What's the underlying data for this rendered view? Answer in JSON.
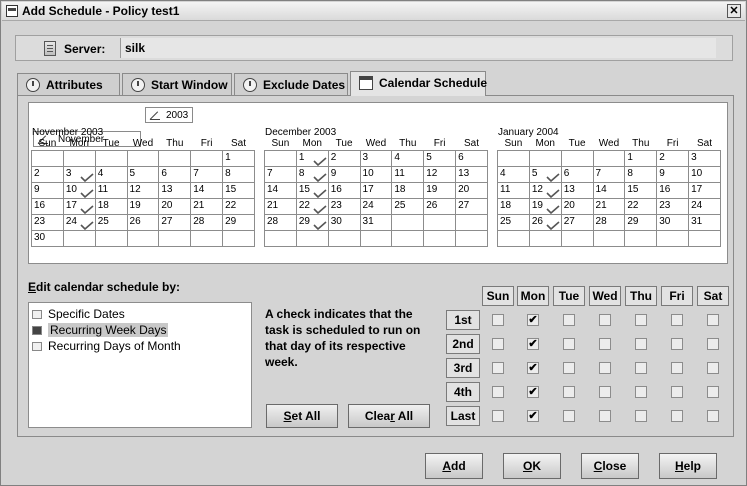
{
  "window": {
    "title": "Add Schedule - Policy test1",
    "close_label": "✕"
  },
  "server": {
    "label": "Server:",
    "value": "silk"
  },
  "tabs": [
    {
      "label": "Attributes",
      "icon": "gear-icon"
    },
    {
      "label": "Start Window",
      "icon": "clock-icon"
    },
    {
      "label": "Exclude Dates",
      "icon": "clock-icon"
    },
    {
      "label": "Calendar Schedule",
      "icon": "calendar-icon",
      "active": true
    }
  ],
  "nav": {
    "month": "November",
    "year": "2003"
  },
  "weekday_headers": [
    "Sun",
    "Mon",
    "Tue",
    "Wed",
    "Thu",
    "Fri",
    "Sat"
  ],
  "months": [
    {
      "title": "November 2003",
      "weeks": [
        [
          "",
          "",
          "",
          "",
          "",
          "",
          "1"
        ],
        [
          "2",
          "3",
          "4",
          "5",
          "6",
          "7",
          "8"
        ],
        [
          "9",
          "10",
          "11",
          "12",
          "13",
          "14",
          "15"
        ],
        [
          "16",
          "17",
          "18",
          "19",
          "20",
          "21",
          "22"
        ],
        [
          "23",
          "24",
          "25",
          "26",
          "27",
          "28",
          "29"
        ],
        [
          "30",
          "",
          "",
          "",
          "",
          "",
          ""
        ]
      ],
      "checked": [
        "3",
        "10",
        "17",
        "24"
      ]
    },
    {
      "title": "December 2003",
      "weeks": [
        [
          "",
          "1",
          "2",
          "3",
          "4",
          "5",
          "6"
        ],
        [
          "7",
          "8",
          "9",
          "10",
          "11",
          "12",
          "13"
        ],
        [
          "14",
          "15",
          "16",
          "17",
          "18",
          "19",
          "20"
        ],
        [
          "21",
          "22",
          "23",
          "24",
          "25",
          "26",
          "27"
        ],
        [
          "28",
          "29",
          "30",
          "31",
          "",
          "",
          ""
        ],
        [
          "",
          "",
          "",
          "",
          "",
          "",
          ""
        ]
      ],
      "checked": [
        "1",
        "8",
        "15",
        "22",
        "29"
      ]
    },
    {
      "title": "January 2004",
      "weeks": [
        [
          "",
          "",
          "",
          "",
          "1",
          "2",
          "3"
        ],
        [
          "4",
          "5",
          "6",
          "7",
          "8",
          "9",
          "10"
        ],
        [
          "11",
          "12",
          "13",
          "14",
          "15",
          "16",
          "17"
        ],
        [
          "18",
          "19",
          "20",
          "21",
          "22",
          "23",
          "24"
        ],
        [
          "25",
          "26",
          "27",
          "28",
          "29",
          "30",
          "31"
        ],
        [
          "",
          "",
          "",
          "",
          "",
          "",
          ""
        ]
      ],
      "checked": [
        "5",
        "12",
        "19",
        "26"
      ]
    }
  ],
  "edit": {
    "label_prefix": "E",
    "label_rest": "dit calendar schedule by:",
    "options": [
      {
        "label": "Specific Dates",
        "selected": false
      },
      {
        "label": "Recurring Week Days",
        "selected": true
      },
      {
        "label": "Recurring Days of Month",
        "selected": false
      }
    ]
  },
  "info_text": "A check indicates that the task is scheduled to run on that day of its respective week.",
  "buttons": {
    "set_all_prefix": "S",
    "set_all_rest": "et All",
    "clear_all_prefix": "Clea",
    "clear_all_mid": "r",
    "clear_all_rest": " All"
  },
  "grid": {
    "columns": [
      "Sun",
      "Mon",
      "Tue",
      "Wed",
      "Thu",
      "Fri",
      "Sat"
    ],
    "rows": [
      "1st",
      "2nd",
      "3rd",
      "4th",
      "Last"
    ],
    "checks": [
      [
        false,
        true,
        false,
        false,
        false,
        false,
        false
      ],
      [
        false,
        true,
        false,
        false,
        false,
        false,
        false
      ],
      [
        false,
        true,
        false,
        false,
        false,
        false,
        false
      ],
      [
        false,
        true,
        false,
        false,
        false,
        false,
        false
      ],
      [
        false,
        true,
        false,
        false,
        false,
        false,
        false
      ]
    ],
    "check_glyph": "✔"
  },
  "footer": {
    "add_prefix": "A",
    "add_rest": "dd",
    "ok_prefix": "O",
    "ok_rest": "K",
    "close_prefix": "C",
    "close_rest": "lose",
    "help_prefix": "H",
    "help_rest": "elp"
  }
}
